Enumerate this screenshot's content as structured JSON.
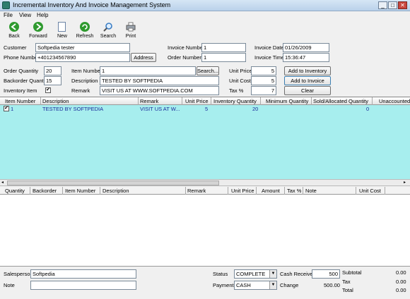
{
  "window": {
    "title": "Incremental Inventory And Invoice Management System",
    "min": "_",
    "max": "□",
    "close": "✕"
  },
  "menu": [
    "File",
    "View",
    "Help"
  ],
  "toolbar": [
    {
      "label": "Back",
      "icon": "back-arrow-icon",
      "color": "#2f9a2f"
    },
    {
      "label": "Forward",
      "icon": "forward-arrow-icon",
      "color": "#2f9a2f"
    },
    {
      "label": "New",
      "icon": "new-document-icon",
      "color": "#dfe8f5"
    },
    {
      "label": "Refresh",
      "icon": "refresh-icon",
      "color": "#2f9a2f"
    },
    {
      "label": "Search",
      "icon": "search-icon",
      "color": "#3b7dc4"
    },
    {
      "label": "Print",
      "icon": "printer-icon",
      "color": "#9aa3ad"
    }
  ],
  "customer": {
    "customer_label": "Customer",
    "customer_value": "Softpedia tester",
    "phone_label": "Phone Number",
    "phone_value": "+401234567890",
    "address_button": "Address"
  },
  "invoice": {
    "invoice_number_label": "Invoice Number",
    "invoice_number_value": "1",
    "order_number_label": "Order Number",
    "order_number_value": "1",
    "invoice_date_label": "Invoice Date",
    "invoice_date_value": "01/26/2009",
    "invoice_time_label": "Invoice Time",
    "invoice_time_value": "15:36:47"
  },
  "item": {
    "order_qty_label": "Order Quantity",
    "order_qty_value": "20",
    "backorder_qty_label": "Backorder Quantity",
    "backorder_qty_value": "15",
    "inventory_item_label": "Inventory Item",
    "inventory_item_checked": "✔",
    "item_number_label": "Item Number",
    "item_number_value": "1",
    "search_button": "Search...",
    "description_label": "Description",
    "description_value": "TESTED BY SOFTPEDIA",
    "remark_label": "Remark",
    "remark_value": "VISIT US AT WWW.SOFTPEDIA.COM",
    "unit_price_label": "Unit Price",
    "unit_price_value": "5",
    "unit_cost_label": "Unit Cost",
    "unit_cost_value": "5",
    "tax_label": "Tax %",
    "tax_value": "7",
    "add_inventory_button": "Add to Inventory",
    "add_invoice_button": "Add to Invoice",
    "clear_button": "Clear"
  },
  "inventory_grid": {
    "columns": [
      "Item Number",
      "Description",
      "Remark",
      "Unit Price",
      "Inventory Quantity",
      "Minimum Quantity",
      "Sold/Allocated Quantity",
      "Unaccounted"
    ],
    "rows": [
      {
        "check": "✔",
        "item_number": "1",
        "description": "TESTED BY SOFTPEDIA",
        "remark": "VISIT US AT W...",
        "unit_price": "5",
        "inventory_qty": "20",
        "minimum_qty": "",
        "sold_qty": "0"
      }
    ]
  },
  "invoice_grid": {
    "columns": [
      "Quantity",
      "Backorder",
      "Item Number",
      "Description",
      "Remark",
      "Unit Price",
      "Amount",
      "Tax %",
      "Note",
      "Unit Cost"
    ]
  },
  "footer": {
    "salesperson_label": "Salesperson",
    "salesperson_value": "Softpedia",
    "note_label": "Note",
    "note_value": "",
    "status_label": "Status",
    "status_value": "COMPLETE",
    "payment_label": "Payment",
    "payment_value": "CASH",
    "cash_received_label": "Cash Received",
    "cash_received_value": "500",
    "change_label": "Change",
    "change_value": "500.00",
    "subtotal_label": "Subtotal",
    "subtotal_value": "0.00",
    "tax_label": "Tax",
    "tax_value": "0.00",
    "total_label": "Total",
    "total_value": "0.00"
  }
}
